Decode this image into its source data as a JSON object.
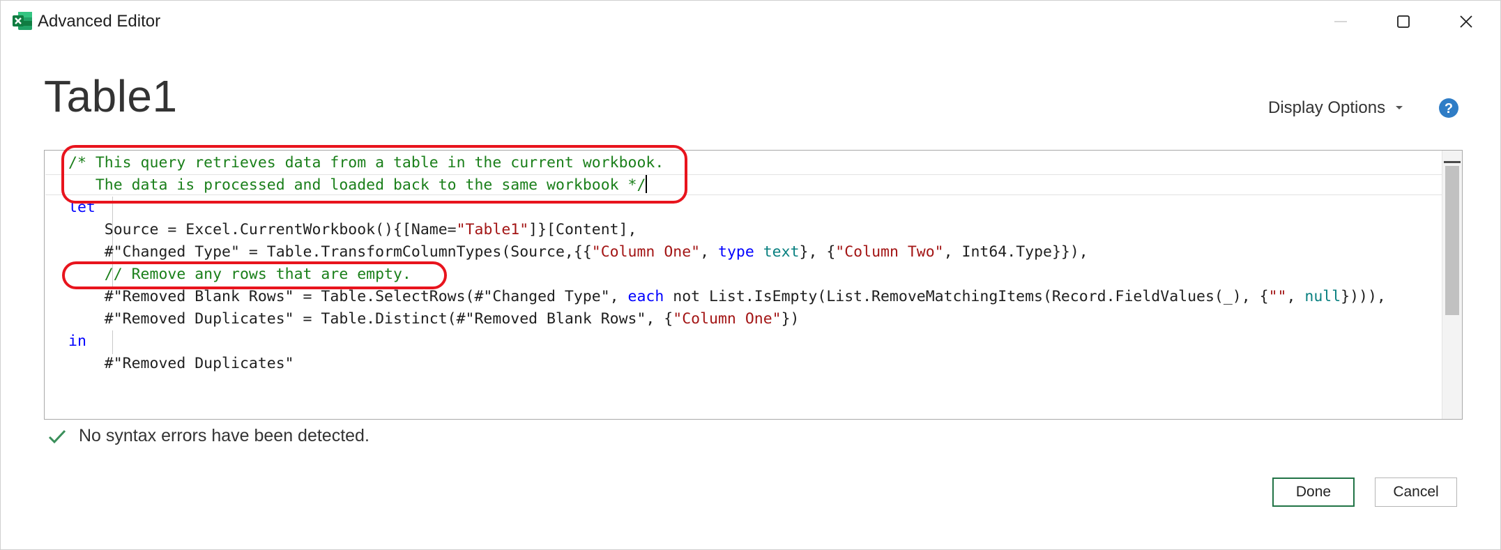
{
  "window": {
    "title": "Advanced Editor",
    "app_icon": "excel-icon",
    "controls": [
      "minimize-icon",
      "maximize-icon",
      "close-icon"
    ]
  },
  "header": {
    "query_name": "Table1",
    "display_options_label": "Display Options",
    "help_icon": "help-icon"
  },
  "editor": {
    "lines": [
      [
        {
          "t": "/* This query retrieves data from a table in the current workbook.",
          "c": "comment"
        }
      ],
      [
        {
          "t": "   The data is processed and loaded back to the same workbook */",
          "c": "comment"
        }
      ],
      [
        {
          "t": "let",
          "c": "kw"
        }
      ],
      [
        {
          "t": "    Source = Excel.CurrentWorkbook(){[Name=",
          "c": ""
        },
        {
          "t": "\"Table1\"",
          "c": "str"
        },
        {
          "t": "]}[Content],",
          "c": ""
        }
      ],
      [
        {
          "t": "    #\"Changed Type\" = Table.TransformColumnTypes(Source,{{",
          "c": ""
        },
        {
          "t": "\"Column One\"",
          "c": "str"
        },
        {
          "t": ", ",
          "c": ""
        },
        {
          "t": "type",
          "c": "kw"
        },
        {
          "t": " ",
          "c": ""
        },
        {
          "t": "text",
          "c": "type"
        },
        {
          "t": "}, {",
          "c": ""
        },
        {
          "t": "\"Column Two\"",
          "c": "str"
        },
        {
          "t": ", Int64.Type}}),",
          "c": ""
        }
      ],
      [
        {
          "t": "    // Remove any rows that are empty.",
          "c": "comment"
        }
      ],
      [
        {
          "t": "    #\"Removed Blank Rows\" = Table.SelectRows(#\"Changed Type\", ",
          "c": ""
        },
        {
          "t": "each",
          "c": "kw"
        },
        {
          "t": " not List.IsEmpty(List.RemoveMatchingItems(Record.FieldValues(_), {",
          "c": ""
        },
        {
          "t": "\"\"",
          "c": "str"
        },
        {
          "t": ", ",
          "c": ""
        },
        {
          "t": "null",
          "c": "type"
        },
        {
          "t": "}))),",
          "c": ""
        }
      ],
      [
        {
          "t": "    #\"Removed Duplicates\" = Table.Distinct(#\"Removed Blank Rows\", {",
          "c": ""
        },
        {
          "t": "\"Column One\"",
          "c": "str"
        },
        {
          "t": "})",
          "c": ""
        }
      ],
      [
        {
          "t": "in",
          "c": "kw"
        }
      ],
      [
        {
          "t": "    #\"Removed Duplicates\"",
          "c": ""
        }
      ]
    ]
  },
  "status": {
    "icon": "checkmark-icon",
    "message": "No syntax errors have been detected."
  },
  "buttons": {
    "done_label": "Done",
    "cancel_label": "Cancel"
  },
  "colors": {
    "comment": "#1a7f1a",
    "keyword": "#0000ff",
    "string": "#a31515",
    "type": "#098080",
    "annotation": "#e8141d",
    "done_border": "#217346"
  }
}
